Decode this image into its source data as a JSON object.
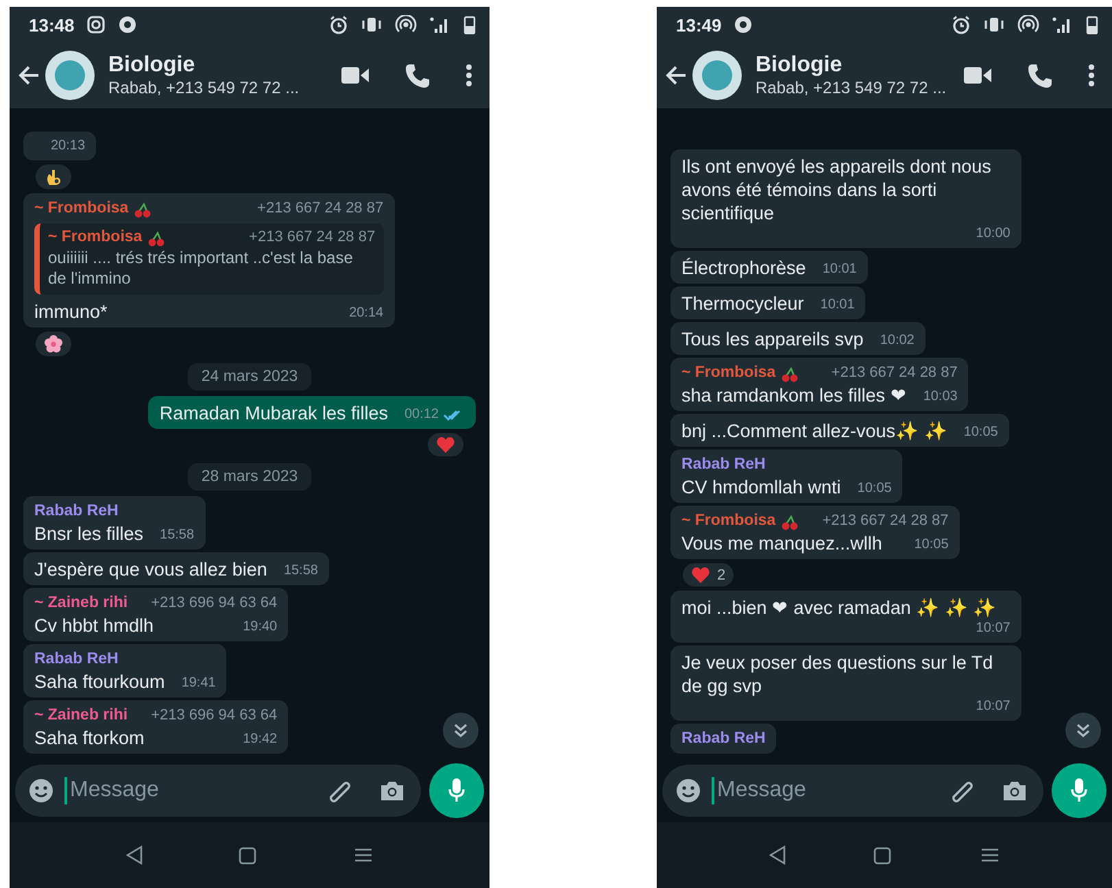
{
  "phones": [
    {
      "status_bar": {
        "time": "13:48",
        "notification_icons": [
          {
            "kind": "camera"
          },
          {
            "kind": "badge"
          }
        ]
      },
      "header": {
        "title": "Biologie",
        "subtitle": "Rabab, +213 549 72 72 ..."
      },
      "messages": [
        {
          "kind": "in",
          "time": "20:13",
          "reaction": {
            "kind": "ok_hand"
          }
        },
        {
          "kind": "in",
          "sender": "~ Fromboisa",
          "cherries": true,
          "color": "#e4573c",
          "phone": "+213 667 24 28 87",
          "quote": {
            "sender": "~ Fromboisa",
            "cherries": true,
            "color": "#e4573c",
            "phone": "+213 667 24 28 87",
            "text": "ouiiiiii .... trés trés important ..c'est la base de l'immino"
          },
          "text": "immuno*",
          "time": "20:14",
          "reaction": {
            "kind": "flower"
          }
        },
        {
          "kind": "date",
          "text": "24 mars 2023"
        },
        {
          "kind": "out",
          "text": "Ramadan Mubarak les filles",
          "time": "00:12",
          "read": true,
          "reaction": {
            "kind": "heart"
          }
        },
        {
          "kind": "date",
          "text": "28 mars 2023"
        },
        {
          "kind": "in",
          "sender": "Rabab ReH",
          "color": "#9d8cf0",
          "text": "Bnsr les filles",
          "time": "15:58"
        },
        {
          "kind": "in",
          "text": "J'espère que vous allez bien",
          "time": "15:58"
        },
        {
          "kind": "in",
          "sender": "~ Zaineb rihi",
          "color": "#ef5b8f",
          "phone": "+213 696 94 63 64",
          "text": "Cv hbbt hmdlh",
          "time": "19:40"
        },
        {
          "kind": "in",
          "sender": "Rabab ReH",
          "color": "#9d8cf0",
          "text": "Saha ftourkoum",
          "time": "19:41"
        },
        {
          "kind": "in",
          "sender": "~ Zaineb rihi",
          "color": "#ef5b8f",
          "phone": "+213 696 94 63 64",
          "text": "Saha ftorkom",
          "time": "19:42"
        }
      ],
      "composer": {
        "placeholder": "Message"
      }
    },
    {
      "status_bar": {
        "time": "13:49",
        "notification_icons": [
          {
            "kind": "badge"
          }
        ]
      },
      "header": {
        "title": "Biologie",
        "subtitle": "Rabab, +213 549 72 72 ..."
      },
      "messages": [
        {
          "kind": "in",
          "text": "Ils ont envoyé les appareils dont nous avons été témoins dans la sorti scientifique",
          "time": "10:00"
        },
        {
          "kind": "in",
          "text": "Électrophorèse",
          "time": "10:01"
        },
        {
          "kind": "in",
          "text": "Thermocycleur",
          "time": "10:01"
        },
        {
          "kind": "in",
          "text": "Tous les appareils svp",
          "time": "10:02"
        },
        {
          "kind": "in",
          "sender": "~ Fromboisa",
          "cherries": true,
          "color": "#e4573c",
          "phone": "+213 667 24 28 87",
          "text": "sha ramdankom les filles ❤",
          "time": "10:03"
        },
        {
          "kind": "in",
          "text": "bnj ...Comment allez-vous✨ ✨",
          "time": "10:05"
        },
        {
          "kind": "in",
          "sender": "Rabab ReH",
          "color": "#9d8cf0",
          "text": "CV hmdomllah wnti",
          "time": "10:05"
        },
        {
          "kind": "in",
          "sender": "~ Fromboisa",
          "cherries": true,
          "color": "#e4573c",
          "phone": "+213 667 24 28 87",
          "text": "Vous me manquez...wllh",
          "time": "10:05",
          "reaction": {
            "kind": "heart",
            "count": "2"
          }
        },
        {
          "kind": "in",
          "text": "moi ...bien ❤ avec ramadan ✨ ✨ ✨",
          "time": "10:07"
        },
        {
          "kind": "in",
          "text": "Je veux poser des questions sur le Td de gg svp",
          "time": "10:07"
        },
        {
          "kind": "in",
          "sender": "Rabab ReH",
          "color": "#9d8cf0"
        }
      ],
      "composer": {
        "placeholder": "Message"
      }
    }
  ]
}
